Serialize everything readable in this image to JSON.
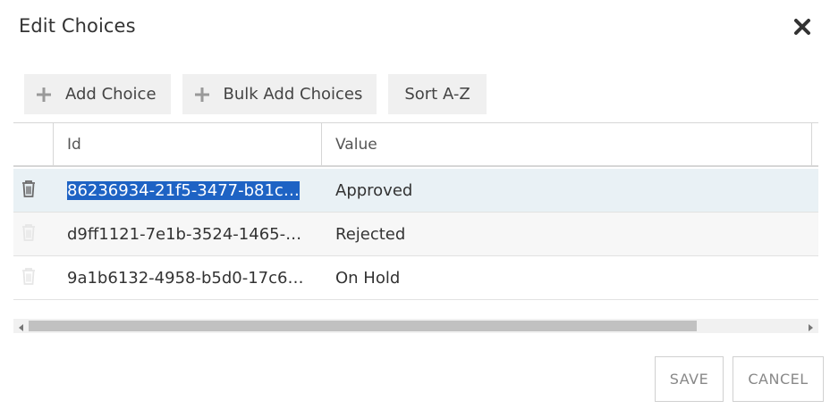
{
  "dialog": {
    "title": "Edit Choices",
    "close_icon": "close-icon"
  },
  "toolbar": {
    "add_choice": "Add Choice",
    "bulk_add": "Bulk Add Choices",
    "sort": "Sort A-Z",
    "plus_icon": "plus-icon"
  },
  "grid": {
    "columns": [
      "Id",
      "Value"
    ],
    "rows": [
      {
        "id": "86236934-21f5-3477-b81c…",
        "value": "Approved",
        "selected": true,
        "delete_icon": "trash-icon"
      },
      {
        "id": "d9ff1121-7e1b-3524-1465-…",
        "value": "Rejected",
        "selected": false,
        "delete_icon": "trash-icon"
      },
      {
        "id": "9a1b6132-4958-b5d0-17c6…",
        "value": "On Hold",
        "selected": false,
        "delete_icon": "trash-icon"
      }
    ]
  },
  "footer": {
    "save": "SAVE",
    "cancel": "CANCEL"
  },
  "colors": {
    "selection_highlight": "#1e63c4",
    "selected_row_bg": "#e9f1f5",
    "button_bg": "#f0f0f0"
  }
}
